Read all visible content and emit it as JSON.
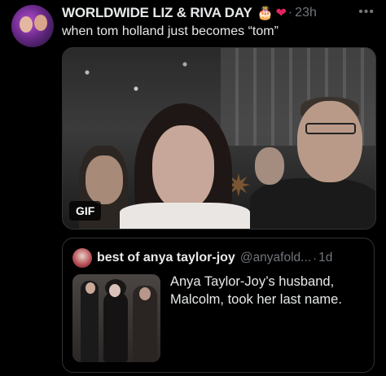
{
  "tweet": {
    "display_name": "WORLDWIDE LIZ & RIVA DAY",
    "emoji_cake": "🎂",
    "emoji_heart": "❤",
    "dot": "·",
    "time": "23h",
    "more": "•••",
    "text": "when tom holland just becomes “tom”",
    "media": {
      "badge": "GIF"
    }
  },
  "quote": {
    "display_name": "best of anya taylor-joy",
    "handle": "@anyafold...",
    "dot": "·",
    "time": "1d",
    "text_lines": [
      "Anya Taylor-Joy’s husband,",
      "Malcolm, took her last name."
    ]
  },
  "colors": {
    "background": "#000000",
    "text": "#e7e9ea",
    "muted": "#71767b",
    "border": "#2f3336",
    "heart": "#e0245e"
  }
}
